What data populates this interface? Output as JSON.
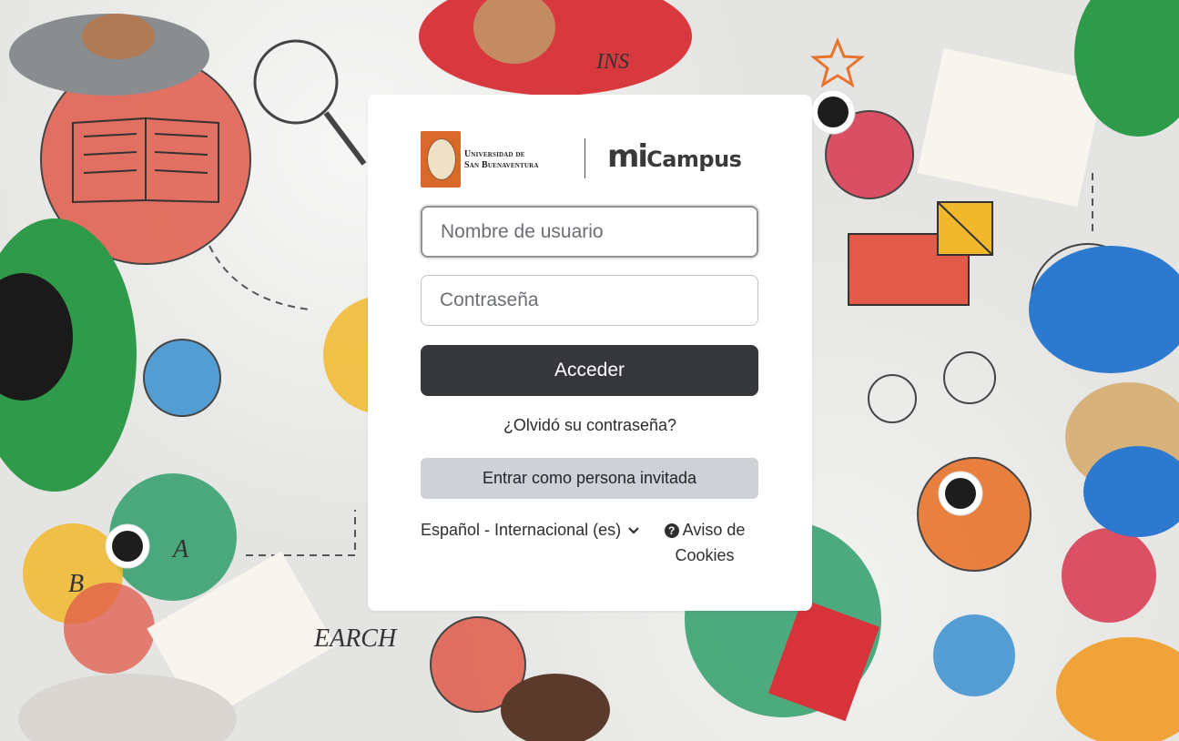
{
  "login": {
    "logos": {
      "university_line1": "Universidad de",
      "university_line2": "San Buenaventura",
      "product_mi": "mi",
      "product_campus": "Campus"
    },
    "username": {
      "placeholder": "Nombre de usuario",
      "value": ""
    },
    "password": {
      "placeholder": "Contraseña",
      "value": ""
    },
    "login_button": "Acceder",
    "forgot_link": "¿Olvidó su contraseña?",
    "guest_button": "Entrar como persona invitada",
    "language": "Español - Internacional (es)",
    "cookies_line1": "Aviso de",
    "cookies_line2": "Cookies"
  },
  "icons": {
    "language_chevron": "chevron-down-icon",
    "cookies": "question-circle-icon"
  },
  "colors": {
    "login_button_bg": "#36373a",
    "guest_button_bg": "#ced1d6",
    "university_orange": "#d9692a",
    "micampus_green": "#2f8f4e"
  }
}
